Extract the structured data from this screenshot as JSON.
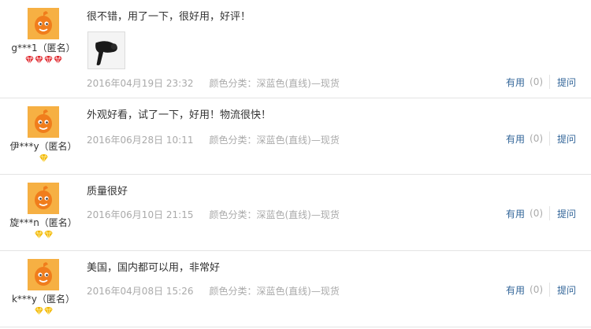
{
  "reviews": [
    {
      "user": "g***1（匿名）",
      "level_icon": "red-diamond-icon",
      "level_count": 4,
      "text": "很不错，用了一下，很好用，好评！",
      "has_photo": true,
      "date": "2016年04月19日 23:32",
      "sku": "颜色分类：深蓝色(直线)—现货",
      "useful_label": "有用",
      "useful_count": "(0)",
      "ask_label": "提问"
    },
    {
      "user": "伊***y（匿名）",
      "level_icon": "yellow-diamond-icon",
      "level_count": 1,
      "text": "外观好看，试了一下，好用！物流很快！",
      "has_photo": false,
      "date": "2016年06月28日 10:11",
      "sku": "颜色分类：深蓝色(直线)—现货",
      "useful_label": "有用",
      "useful_count": "(0)",
      "ask_label": "提问"
    },
    {
      "user": "旋***n（匿名）",
      "level_icon": "yellow-diamond-icon",
      "level_count": 2,
      "text": "质量很好",
      "has_photo": false,
      "date": "2016年06月10日 21:15",
      "sku": "颜色分类：深蓝色(直线)—现货",
      "useful_label": "有用",
      "useful_count": "(0)",
      "ask_label": "提问"
    },
    {
      "user": "k***y（匿名）",
      "level_icon": "yellow-diamond-icon",
      "level_count": 2,
      "text": "美国，国内都可以用，非常好",
      "has_photo": false,
      "date": "2016年04月08日 15:26",
      "sku": "颜色分类：深蓝色(直线)—现货",
      "useful_label": "有用",
      "useful_count": "(0)",
      "ask_label": "提问"
    }
  ],
  "colors": {
    "link": "#336699",
    "muted": "#aaaaaa",
    "divider": "#e4e4e4",
    "avatar_bg": "#f5a623"
  }
}
